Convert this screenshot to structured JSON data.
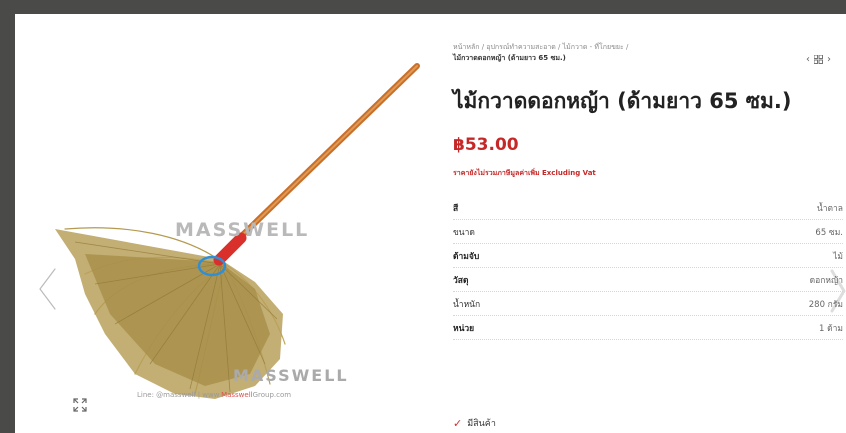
{
  "breadcrumb": {
    "path": "หน้าหลัก / อุปกรณ์ทำความสะอาด / ไม้กวาด - ที่โกยขยะ /",
    "current": "ไม้กวาดดอกหญ้า (ด้ามยาว 65 ซม.)"
  },
  "product": {
    "title": "ไม้กวาดดอกหญ้า (ด้ามยาว 65 ซม.)",
    "price": "฿53.00",
    "vat_note": "ราคายังไม่รวมภาษีมูลค่าเพิ่ม Excluding Vat"
  },
  "attributes": [
    {
      "label": "สี",
      "value": "น้ำตาล"
    },
    {
      "label": "ขนาด",
      "value": "65 ซม."
    },
    {
      "label": "ด้ามจับ",
      "value": "ไม้"
    },
    {
      "label": "วัสดุ",
      "value": "ดอกหญ้า"
    },
    {
      "label": "น้ำหนัก",
      "value": "280 กรัม"
    },
    {
      "label": "หน่วย",
      "value": "1 ด้าม"
    }
  ],
  "stock": {
    "label": "มีสินค้า"
  },
  "watermark": {
    "brand_top": "MASSWELL",
    "brand_bottom": "MASSWELL",
    "line_prefix": "Line: @masswell | www.",
    "line_brand": "Masswell",
    "line_suffix": "Group.com"
  },
  "icons": {
    "prev": "chevron-left-icon",
    "next": "chevron-right-icon",
    "zoom": "expand-icon",
    "grid": "grid-icon",
    "check": "check-icon"
  },
  "colors": {
    "price": "#c62828",
    "handle": "#c8702a",
    "background": "#4a4a48"
  }
}
